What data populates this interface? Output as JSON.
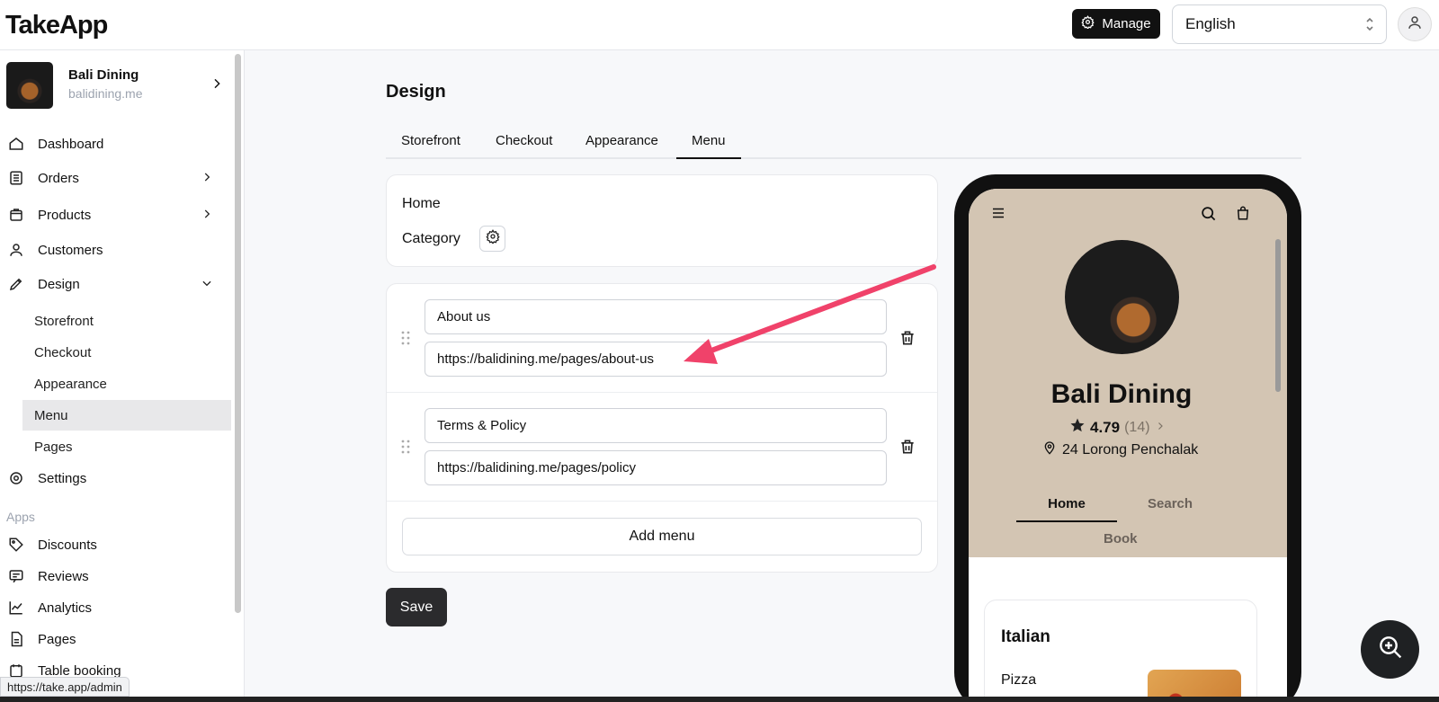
{
  "header": {
    "logo": "TakeApp",
    "manage_label": "Manage",
    "language": "English"
  },
  "sidebar": {
    "store_name": "Bali Dining",
    "store_url": "balidining.me",
    "nav": {
      "dashboard": "Dashboard",
      "orders": "Orders",
      "products": "Products",
      "customers": "Customers",
      "design": "Design",
      "settings": "Settings"
    },
    "design_sub": {
      "storefront": "Storefront",
      "checkout": "Checkout",
      "appearance": "Appearance",
      "menu": "Menu",
      "pages": "Pages"
    },
    "apps_label": "Apps",
    "apps": {
      "discounts": "Discounts",
      "reviews": "Reviews",
      "analytics": "Analytics",
      "pages": "Pages",
      "table_booking": "Table booking"
    },
    "status_url": "https://take.app/admin"
  },
  "main": {
    "title": "Design",
    "tabs": [
      "Storefront",
      "Checkout",
      "Appearance",
      "Menu"
    ],
    "active_tab": "Menu",
    "fixed_items": {
      "home": "Home",
      "category": "Category"
    },
    "menu_items": [
      {
        "label": "About us",
        "url": "https://balidining.me/pages/about-us"
      },
      {
        "label": "Terms & Policy",
        "url": "https://balidining.me/pages/policy"
      }
    ],
    "add_menu_label": "Add menu",
    "save_label": "Save",
    "annotation_color": "#f0426a"
  },
  "preview": {
    "store_name": "Bali Dining",
    "rating": "4.79",
    "review_count": "(14)",
    "address": "24 Lorong Penchalak",
    "tabs": {
      "home": "Home",
      "search": "Search",
      "book": "Book"
    },
    "category_title": "Italian",
    "first_item": "Pizza",
    "hero_color": "#d3c5b3"
  }
}
